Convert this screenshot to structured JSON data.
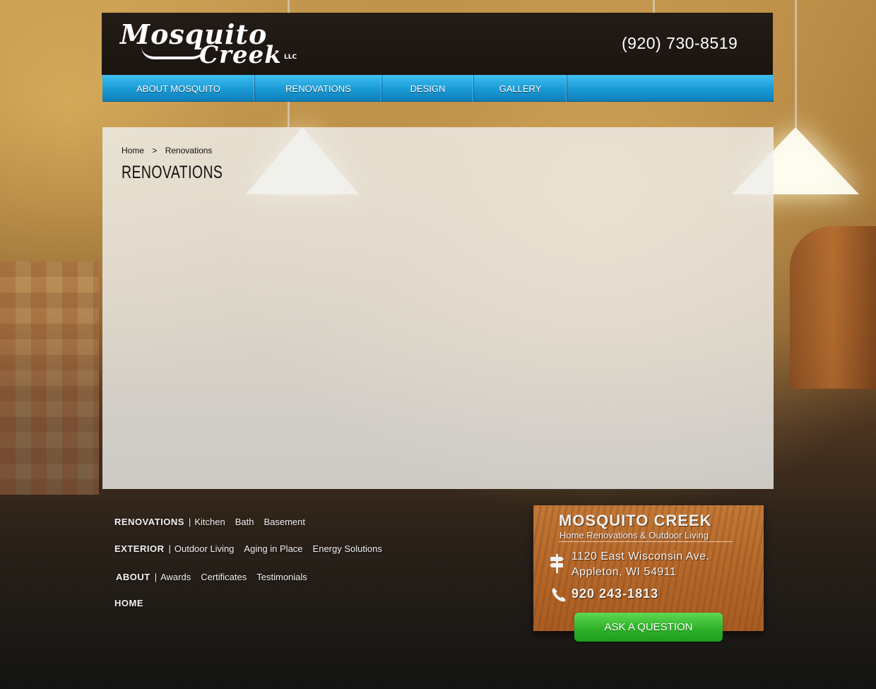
{
  "header": {
    "logo_line1": "Mosquito",
    "logo_line2": "Creek",
    "logo_llc": "LLC",
    "phone": "(920) 730-8519"
  },
  "nav": {
    "items": [
      {
        "label": "ABOUT MOSQUITO"
      },
      {
        "label": "RENOVATIONS"
      },
      {
        "label": "DESIGN"
      },
      {
        "label": "GALLERY"
      }
    ]
  },
  "breadcrumb": {
    "home": "Home",
    "separator": ">",
    "current": "Renovations"
  },
  "page": {
    "title": "RENOVATIONS"
  },
  "footer": {
    "separator": "|",
    "groups": [
      {
        "category": "RENOVATIONS",
        "links": [
          "Kitchen",
          "Bath",
          "Basement"
        ]
      },
      {
        "category": "EXTERIOR",
        "links": [
          "Outdoor Living",
          "Aging in Place",
          "Energy Solutions"
        ]
      },
      {
        "category": "ABOUT",
        "links": [
          "Awards",
          "Certificates",
          "Testimonials"
        ]
      },
      {
        "category": "HOME",
        "links": []
      }
    ]
  },
  "card": {
    "title": "MOSQUITO CREEK",
    "subtitle": "Home Renovations & Outdoor Living",
    "address_line1": "1120 East Wisconsin Ave.",
    "address_line2": "Appleton, WI 54911",
    "phone": "920 243-1813",
    "button": "ASK A QUESTION"
  },
  "colors": {
    "nav_blue": "#1a9ad6",
    "button_green": "#2fb32a",
    "header_dark": "#1a140f"
  }
}
